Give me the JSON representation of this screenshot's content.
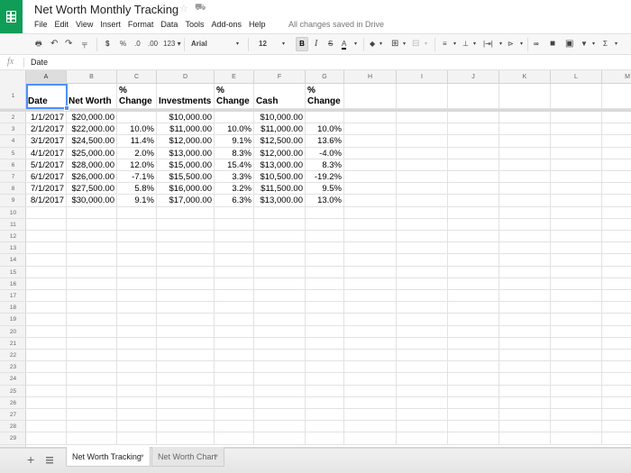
{
  "app": {
    "title": "Net Worth Monthly Tracking",
    "save_status": "All changes saved in Drive",
    "menu": [
      "File",
      "Edit",
      "View",
      "Insert",
      "Format",
      "Data",
      "Tools",
      "Add-ons",
      "Help"
    ]
  },
  "toolbar": {
    "currency": "$",
    "percent": "%",
    "decrease_decimal": ".0",
    "increase_decimal": ".00",
    "more_formats": "123",
    "font": "Arial",
    "font_size": "12",
    "bold": "B",
    "italic": "I",
    "strikethrough": "S",
    "text_color": "A",
    "sum": "Σ"
  },
  "formula_bar": {
    "fx": "fx",
    "value": "Date"
  },
  "grid": {
    "columns": [
      "A",
      "B",
      "C",
      "D",
      "E",
      "F",
      "G",
      "H",
      "I",
      "J",
      "K",
      "L",
      "M"
    ],
    "active_column": "A",
    "row_numbers": [
      "1",
      "2",
      "3",
      "4",
      "5",
      "6",
      "7",
      "8",
      "9",
      "10",
      "11",
      "12",
      "13",
      "14",
      "15",
      "16",
      "17",
      "18",
      "19",
      "20",
      "21",
      "22",
      "23",
      "24",
      "25",
      "26",
      "27",
      "28",
      "29"
    ],
    "headers": [
      "Date",
      "Net Worth",
      "% Change",
      "Investments",
      "% Change",
      "Cash",
      "% Change"
    ],
    "rows": [
      [
        "1/1/2017",
        "$20,000.00",
        "",
        "$10,000.00",
        "",
        "$10,000.00",
        ""
      ],
      [
        "2/1/2017",
        "$22,000.00",
        "10.0%",
        "$11,000.00",
        "10.0%",
        "$11,000.00",
        "10.0%"
      ],
      [
        "3/1/2017",
        "$24,500.00",
        "11.4%",
        "$12,000.00",
        "9.1%",
        "$12,500.00",
        "13.6%"
      ],
      [
        "4/1/2017",
        "$25,000.00",
        "2.0%",
        "$13,000.00",
        "8.3%",
        "$12,000.00",
        "-4.0%"
      ],
      [
        "5/1/2017",
        "$28,000.00",
        "12.0%",
        "$15,000.00",
        "15.4%",
        "$13,000.00",
        "8.3%"
      ],
      [
        "6/1/2017",
        "$26,000.00",
        "-7.1%",
        "$15,500.00",
        "3.3%",
        "$10,500.00",
        "-19.2%"
      ],
      [
        "7/1/2017",
        "$27,500.00",
        "5.8%",
        "$16,000.00",
        "3.2%",
        "$11,500.00",
        "9.5%"
      ],
      [
        "8/1/2017",
        "$30,000.00",
        "9.1%",
        "$17,000.00",
        "6.3%",
        "$13,000.00",
        "13.0%"
      ]
    ],
    "selected_cell": "A1"
  },
  "sheets": {
    "add_label": "+",
    "tabs": [
      {
        "label": "Net Worth Tracking",
        "active": true
      },
      {
        "label": "Net Worth Chart",
        "active": false
      }
    ]
  },
  "colors": {
    "brand": "#0f9d58",
    "selection": "#4d90fe"
  }
}
